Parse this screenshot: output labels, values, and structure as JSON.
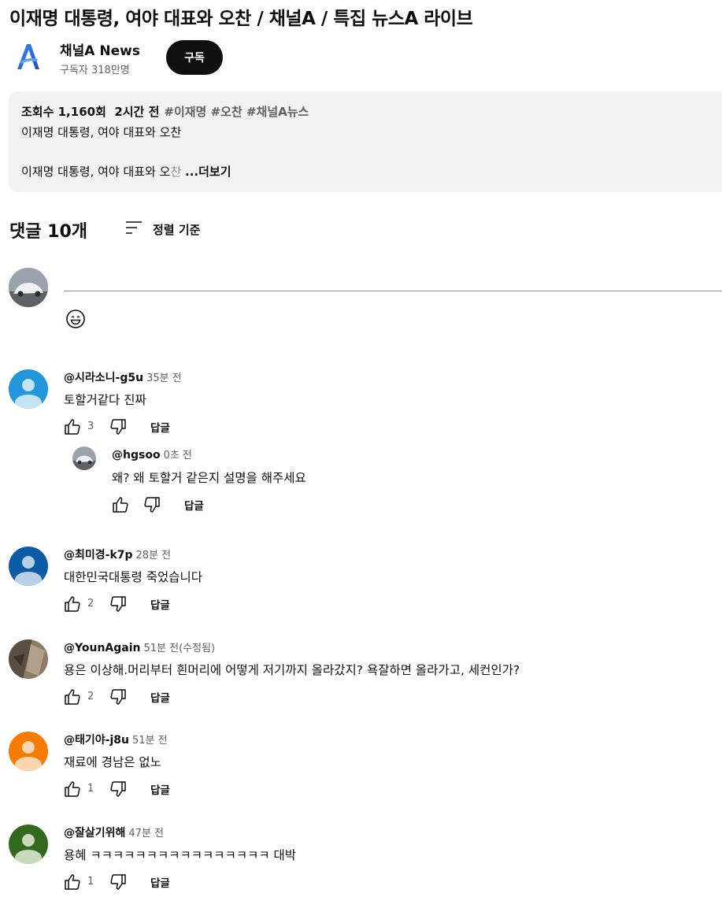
{
  "video": {
    "title": "이재명 대통령, 여야 대표와 오찬 / 채널A / 특집 뉴스A 라이브"
  },
  "channel": {
    "name": "채널A News",
    "subscribers": "구독자 318만명",
    "subscribe_label": "구독",
    "brand_color": "#2b74e0"
  },
  "description": {
    "meta": "조회수 1,160회  2시간 전",
    "tags": "#이재명 #오찬 #채널A뉴스",
    "line1": "이재명 대통령, 여야 대표와 오찬",
    "line2": "이재명 대통령, 여야 대표와 오",
    "line2_fade": "찬 ",
    "more_label": "...더보기"
  },
  "comments_section": {
    "count_label": "댓글 10개",
    "sort_label": "정렬 기준",
    "input_placeholder": ""
  },
  "comments": [
    {
      "author": "@시라소니-g5u",
      "time": "35분 전",
      "text": "토할거같다 진짜",
      "likes": "3",
      "reply_label": "답글",
      "avatar_color": "#2196d8",
      "replies": [
        {
          "author": "@hgsoo",
          "time": "0초 전",
          "text": "왜? 왜 토할거 같은지 설명을 해주세요",
          "likes": "",
          "reply_label": "답글"
        }
      ]
    },
    {
      "author": "@최미경-k7p",
      "time": "28분 전",
      "text": "대한민국대통령 죽었습니다",
      "likes": "2",
      "reply_label": "답글",
      "avatar_color": "#0b5ba5"
    },
    {
      "author": "@YounAgain",
      "time": "51분 전(수정됨)",
      "text": "용은 이상해.머리부터 흰머리에 어떻게 저기까지 올라갔지? 욕잘하면 올라가고, 세컨인가?",
      "likes": "2",
      "reply_label": "답글",
      "avatar_color": "#7a6a5a"
    },
    {
      "author": "@태기야-j8u",
      "time": "51분 전",
      "text": "재료에 경남은 없노",
      "likes": "1",
      "reply_label": "답글",
      "avatar_color": "#f57c00"
    },
    {
      "author": "@잘살기위해",
      "time": "47분 전",
      "text": "용혜 ㅋㅋㅋㅋㅋㅋㅋㅋㅋㅋㅋㅋㅋㅋㅋㅋ 대박",
      "likes": "1",
      "reply_label": "답글",
      "avatar_color": "#33691e"
    }
  ]
}
